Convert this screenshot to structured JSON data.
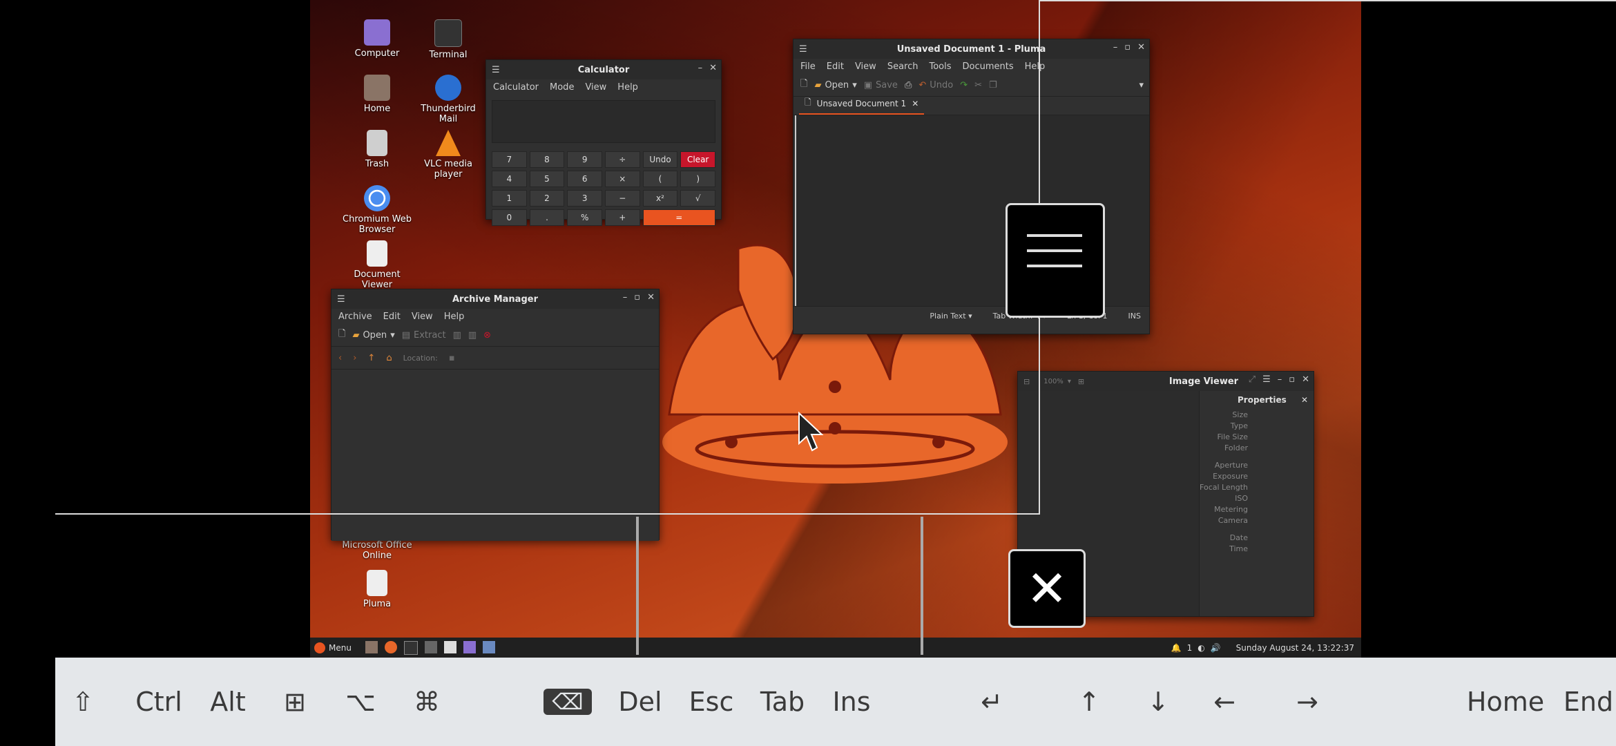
{
  "desktop_icons": [
    {
      "label": "Computer",
      "icon": "computer-icon",
      "color": "#8a6fd1"
    },
    {
      "label": "Terminal",
      "icon": "terminal-icon",
      "color": "#333333"
    },
    {
      "label": "Home",
      "icon": "home-folder-icon",
      "color": "#8a7466"
    },
    {
      "label": "Thunderbird Mail",
      "icon": "thunderbird-icon",
      "color": "#2a6fd1"
    },
    {
      "label": "Trash",
      "icon": "trash-icon",
      "color": "#cfcfcf"
    },
    {
      "label": "VLC media player",
      "icon": "vlc-icon",
      "color": "#f08a1c"
    },
    {
      "label": "Chromium Web Browser",
      "icon": "chromium-icon",
      "color": "#4a8df0"
    },
    {
      "label": "Document Viewer",
      "icon": "document-viewer-icon",
      "color": "#eeeeee"
    },
    {
      "label": "Microsoft Office Online",
      "icon": "office-icon",
      "color": "#d04a2a"
    },
    {
      "label": "Pluma",
      "icon": "pluma-icon",
      "color": "#eeeeee"
    }
  ],
  "calculator": {
    "title": "Calculator",
    "menu": [
      "Calculator",
      "Mode",
      "View",
      "Help"
    ],
    "keys": [
      "7",
      "8",
      "9",
      "÷",
      "Undo",
      "Clear",
      "4",
      "5",
      "6",
      "×",
      "(",
      ")",
      "1",
      "2",
      "3",
      "−",
      "x²",
      "√",
      "0",
      ".",
      "%",
      "+",
      "="
    ]
  },
  "pluma": {
    "title": "Unsaved Document 1 - Pluma",
    "menu": [
      "File",
      "Edit",
      "View",
      "Search",
      "Tools",
      "Documents",
      "Help"
    ],
    "toolbar": {
      "open": "Open",
      "save": "Save",
      "undo": "Undo"
    },
    "tab": "Unsaved Document 1",
    "status": {
      "language": "Plain Text",
      "tab_width": "Tab Width: 4",
      "position": "Ln 1, Col 1",
      "mode": "INS"
    }
  },
  "archive": {
    "title": "Archive Manager",
    "menu": [
      "Archive",
      "Edit",
      "View",
      "Help"
    ],
    "toolbar": {
      "open": "Open",
      "extract": "Extract"
    },
    "location": "Location:"
  },
  "image_viewer": {
    "title": "Image Viewer",
    "zoom": "100%",
    "properties_title": "Properties",
    "properties": [
      "Size",
      "Type",
      "File Size",
      "Folder",
      "",
      "Aperture",
      "Exposure",
      "Focal Length",
      "ISO",
      "Metering",
      "Camera",
      "",
      "Date",
      "Time"
    ]
  },
  "taskbar": {
    "menu_label": "Menu",
    "tray_count": "1",
    "clock": "Sunday August 24, 13:22:37"
  },
  "keyboard": {
    "keys": [
      "⇧",
      "Ctrl",
      "Alt",
      "⊞",
      "⌥",
      "⌘",
      "⌫",
      "Del",
      "Esc",
      "Tab",
      "Ins",
      "↵",
      "↑",
      "↓",
      "←",
      "→",
      "Home",
      "End"
    ]
  }
}
